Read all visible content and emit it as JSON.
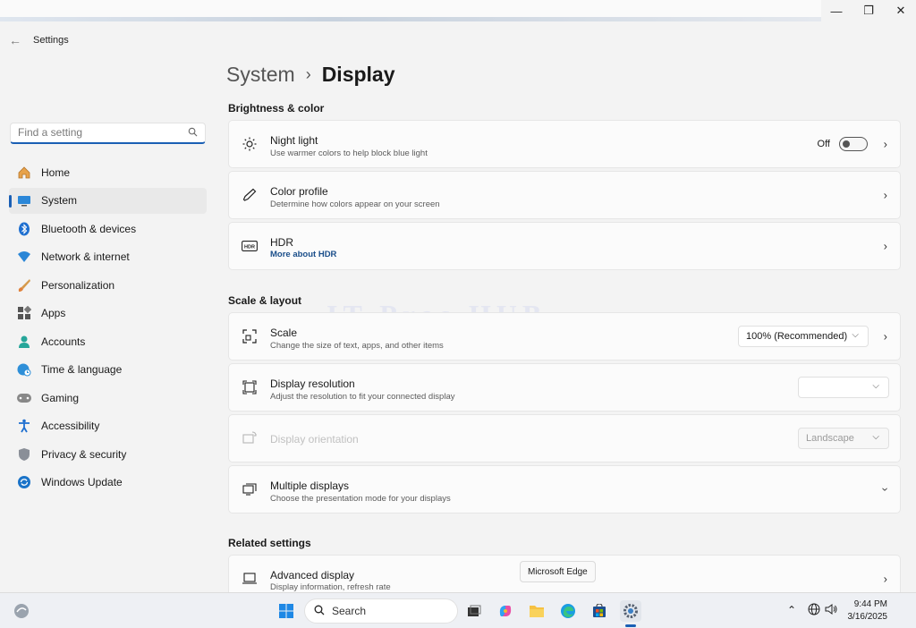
{
  "window": {
    "title": "Settings",
    "controls": {
      "minimize": "—",
      "maximize": "❐",
      "close": "✕"
    }
  },
  "search": {
    "placeholder": "Find a setting"
  },
  "nav": {
    "items": [
      {
        "label": "Home",
        "icon": "home-icon"
      },
      {
        "label": "System",
        "icon": "system-icon",
        "selected": true
      },
      {
        "label": "Bluetooth & devices",
        "icon": "bluetooth-icon"
      },
      {
        "label": "Network & internet",
        "icon": "wifi-icon"
      },
      {
        "label": "Personalization",
        "icon": "brush-icon"
      },
      {
        "label": "Apps",
        "icon": "apps-icon"
      },
      {
        "label": "Accounts",
        "icon": "account-icon"
      },
      {
        "label": "Time & language",
        "icon": "globe-clock-icon"
      },
      {
        "label": "Gaming",
        "icon": "gamepad-icon"
      },
      {
        "label": "Accessibility",
        "icon": "accessibility-icon"
      },
      {
        "label": "Privacy & security",
        "icon": "shield-icon"
      },
      {
        "label": "Windows Update",
        "icon": "update-icon"
      }
    ]
  },
  "breadcrumb": {
    "parent": "System",
    "separator": "›",
    "current": "Display"
  },
  "sections": {
    "brightness": "Brightness & color",
    "scale": "Scale & layout",
    "related": "Related settings"
  },
  "cards": {
    "night_light": {
      "title": "Night light",
      "subtitle": "Use warmer colors to help block blue light",
      "state": "Off",
      "on": false,
      "icon": "sun-icon"
    },
    "color_profile": {
      "title": "Color profile",
      "subtitle": "Determine how colors appear on your screen",
      "icon": "eyedropper-icon"
    },
    "hdr": {
      "title": "HDR",
      "link": "More about HDR",
      "icon": "hdr-icon"
    },
    "scale": {
      "title": "Scale",
      "subtitle": "Change the size of text, apps, and other items",
      "value": "100% (Recommended)",
      "icon": "scale-icon"
    },
    "resolution": {
      "title": "Display resolution",
      "subtitle": "Adjust the resolution to fit your connected display",
      "value": "",
      "icon": "resolution-icon"
    },
    "orientation": {
      "title": "Display orientation",
      "value": "Landscape",
      "disabled": true,
      "icon": "orientation-icon"
    },
    "multiple": {
      "title": "Multiple displays",
      "subtitle": "Choose the presentation mode for your displays",
      "icon": "multi-display-icon"
    },
    "advanced": {
      "title": "Advanced display",
      "subtitle": "Display information, refresh rate",
      "icon": "monitor-icon"
    }
  },
  "watermark": "IT Pros HUB",
  "tooltip": "Microsoft Edge",
  "taskbar": {
    "search_label": "Search",
    "time": "9:44 PM",
    "date": "3/16/2025"
  },
  "colors": {
    "accent": "#1a5fb4",
    "background": "#f3f3f3",
    "card": "#fbfbfb"
  }
}
